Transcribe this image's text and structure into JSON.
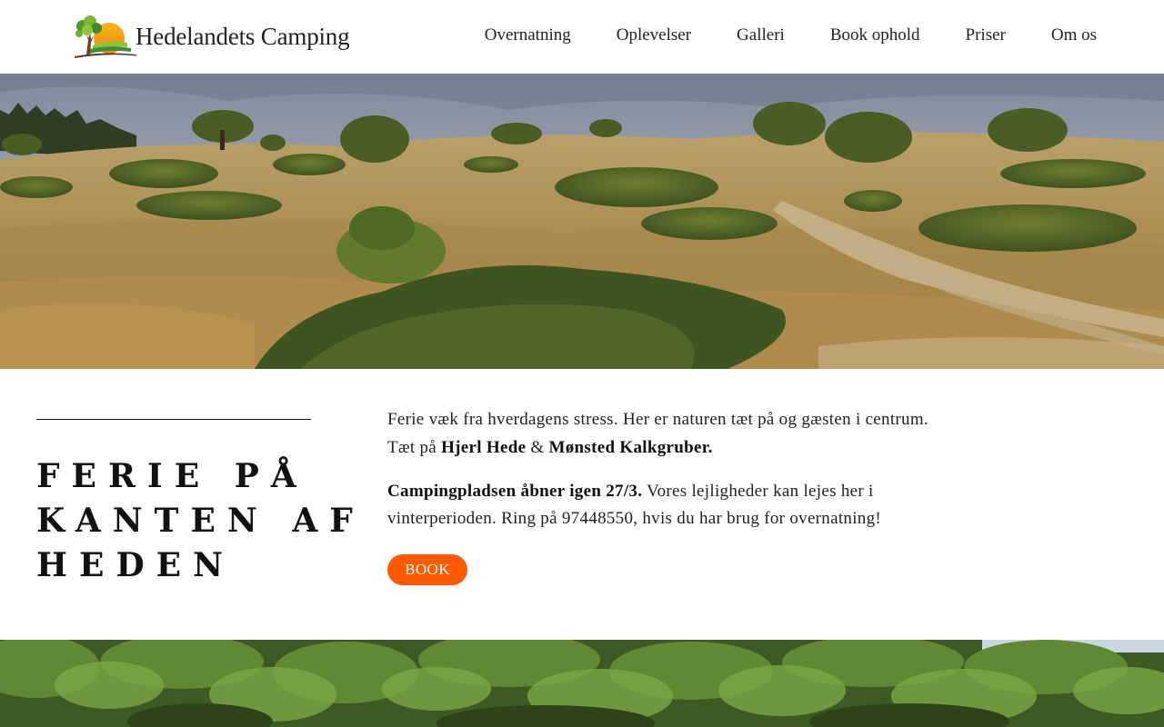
{
  "header": {
    "logo_text": "Hedelandets Camping",
    "logo_icon": "tree-sunset-logo-icon",
    "nav": [
      {
        "label": "Overnatning"
      },
      {
        "label": "Oplevelser"
      },
      {
        "label": "Galleri"
      },
      {
        "label": "Book ophold"
      },
      {
        "label": "Priser"
      },
      {
        "label": "Om os"
      }
    ]
  },
  "hero": {
    "image": "heathland-landscape-photo"
  },
  "intro": {
    "headline_lines": [
      "FERIE PÅ",
      "KANTEN AF",
      "HEDEN"
    ],
    "paragraph1": {
      "text": "Ferie væk fra hverdagens stress. Her er naturen tæt på og gæsten i centrum. Tæt på ",
      "place1": "Hjerl Hede",
      "and": " & ",
      "place2": "Mønsted Kalkgruber."
    },
    "paragraph2": {
      "bold": "Campingpladsen åbner igen 27/3.",
      "text": " Vores lejligheder kan lejes her i vinterperioden. Ring på 97448550, hvis du har brug for overnatning!"
    },
    "button_label": "BOOK"
  },
  "bottom": {
    "image": "forest-trees-photo"
  },
  "colors": {
    "accent": "#ff5a00",
    "text": "#222222",
    "background": "#ffffff"
  }
}
